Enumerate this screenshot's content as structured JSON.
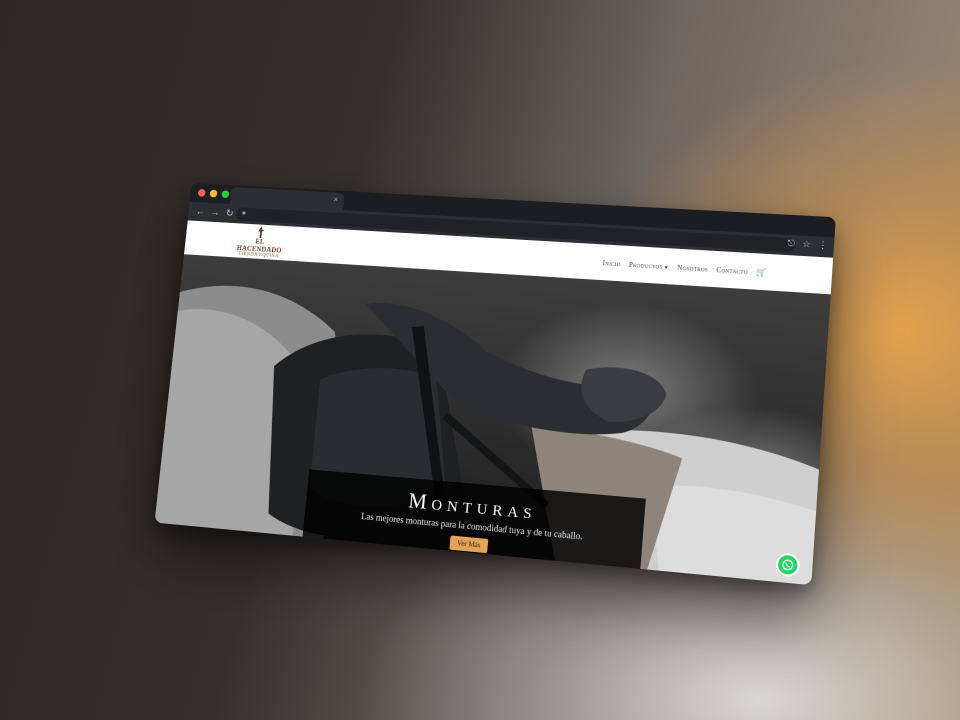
{
  "browser": {
    "tab_close": "×",
    "icons": [
      "back-arrow-icon",
      "forward-arrow-icon",
      "reload-icon",
      "lock-icon",
      "share-icon",
      "star-icon",
      "menu-dots-icon"
    ]
  },
  "site": {
    "logo": {
      "name": "EL HACENDADO",
      "subtitle": "TIENDA EQUINA"
    },
    "nav": {
      "items": [
        "Inicio",
        "Productos",
        "Nosotros",
        "Contacto"
      ]
    },
    "hero": {
      "title": "Monturas",
      "text": "Las mejores monturas para la comodidad tuya y de tu caballo.",
      "button": "Ver Más",
      "slides": 3,
      "active_slide": 1
    }
  },
  "colors": {
    "accent": "#e4a35a",
    "brand": "#6a3d1e",
    "whatsapp": "#25d366"
  }
}
